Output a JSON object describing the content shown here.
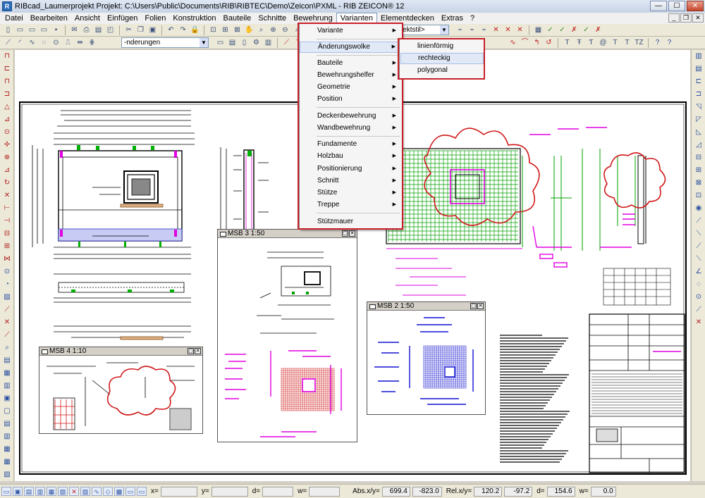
{
  "window": {
    "title": "RIBcad_Laumerprojekt Projekt: C:\\Users\\Public\\Documents\\RIB\\RIBTEC\\Demo\\Zeicon\\PXML  -  RIB ZEICON® 12",
    "app_icon": "R",
    "minimize": "—",
    "maximize": "☐",
    "close": "✕"
  },
  "menubar": {
    "items": [
      "Datei",
      "Bearbeiten",
      "Ansicht",
      "Einfügen",
      "Folien",
      "Konstruktion",
      "Bauteile",
      "Schnitte",
      "Bewehrung",
      "Varianten",
      "Elementdecken",
      "Extras",
      "?"
    ],
    "active": "Varianten",
    "mdi": [
      "_",
      "❐",
      "✕"
    ]
  },
  "toolbar1": {
    "combo_style": "jektstil>"
  },
  "toolbar2": {
    "combo_changes": "-nderungen"
  },
  "menu_varianten": {
    "items": [
      {
        "label": "Variante",
        "sub": true
      },
      {
        "label": "Änderungswolke",
        "sub": true
      },
      {
        "label": "Bauteile",
        "sub": true
      },
      {
        "label": "Bewehrungshelfer",
        "sub": true
      },
      {
        "label": "Geometrie",
        "sub": true
      },
      {
        "label": "Position",
        "sub": true
      },
      {
        "label": "Deckenbewehrung",
        "sub": true
      },
      {
        "label": "Wandbewehrung",
        "sub": true
      },
      {
        "label": "Fundamente",
        "sub": true
      },
      {
        "label": "Holzbau",
        "sub": true
      },
      {
        "label": "Positionierung",
        "sub": true
      },
      {
        "label": "Schnitt",
        "sub": true
      },
      {
        "label": "Stütze",
        "sub": true
      },
      {
        "label": "Treppe",
        "sub": true
      },
      {
        "label": "Stützmauer",
        "sub": false
      }
    ],
    "highlight_color": "#c8202a"
  },
  "submenu_aenderungswolke": {
    "items": [
      "linienförmig",
      "rechteckig",
      "polygonal"
    ],
    "hovered": "rechteckig"
  },
  "detail_windows": [
    {
      "title": "MSB 3    1:50"
    },
    {
      "title": "MSB 2    1:50"
    },
    {
      "title": "MSB 4    1:10"
    }
  ],
  "statusbar": {
    "x_label": "x=",
    "y_label": "y=",
    "d_label": "d=",
    "w_label": "w=",
    "abs_label": "Abs.x/y=",
    "abs_x": "699.4",
    "abs_y": "-823.0",
    "rel_label": "Rel.x/y=",
    "rel_x": "120.2",
    "rel_y": "-97.2",
    "d2_label": "d=",
    "d2_value": "154.6",
    "w2_label": "w=",
    "w2_value": "0.0"
  },
  "colors": {
    "red_highlight": "#c8202a",
    "magenta": "#e000e0",
    "green": "#00a000",
    "blue": "#1010d0",
    "cloud_red": "#d01818"
  }
}
